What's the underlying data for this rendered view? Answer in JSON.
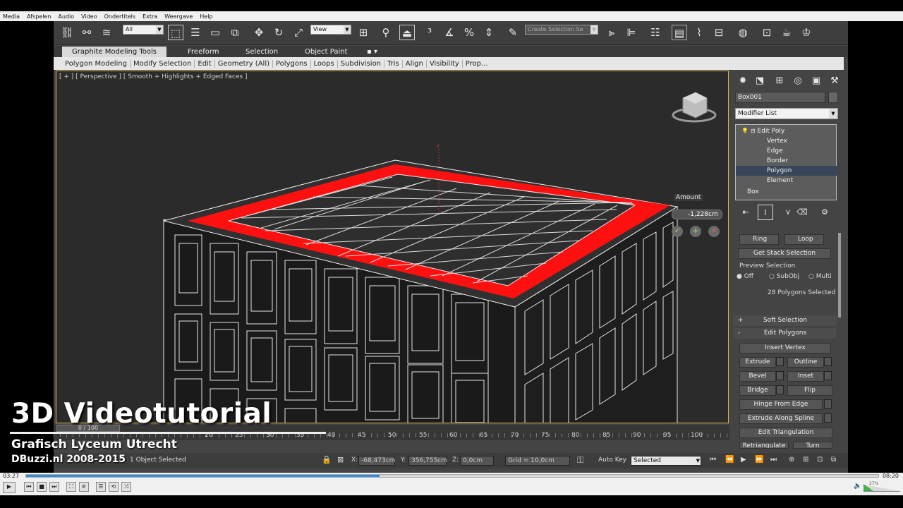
{
  "vlc": {
    "menu": [
      "Media",
      "Afspelen",
      "Audio",
      "Video",
      "Ondertitels",
      "Extra",
      "Weergave",
      "Help"
    ],
    "time_elapsed": "03:27",
    "time_total": "08:20",
    "progress": 0.415,
    "volume_label": "27%"
  },
  "toolbar": {
    "selection_filter": "All",
    "ref_coord": "View",
    "named_selection": "Create Selection Se"
  },
  "ribbon": {
    "tabs": [
      "Graphite Modeling Tools",
      "Freeform",
      "Selection",
      "Object Paint"
    ],
    "panels": [
      "Polygon Modeling",
      "Modify Selection",
      "Edit",
      "Geometry (All)",
      "Polygons",
      "Loops",
      "Subdivision",
      "Tris",
      "Align",
      "Visibility",
      "Prop..."
    ]
  },
  "viewport": {
    "label": "[ + ] [ Perspective ] [ Smooth + Highlights + Edged Faces ]",
    "caddy_title": "Amount",
    "caddy_value": "-1,228cm",
    "axis_z": "z"
  },
  "command_panel": {
    "object_name": "Box001",
    "modifier_list": "Modifier List",
    "stack": {
      "edit_poly": "Edit Poly",
      "vertex": "Vertex",
      "edge": "Edge",
      "border": "Border",
      "polygon": "Polygon",
      "element": "Element",
      "box": "Box"
    },
    "ring": "Ring",
    "loop": "Loop",
    "get_stack_selection": "Get Stack Selection",
    "preview_selection": "Preview Selection",
    "preview_off": "Off",
    "preview_subobj": "SubObj",
    "preview_multi": "Multi",
    "selected_info": "28 Polygons Selected",
    "soft_selection": "Soft Selection",
    "soft_sign": "+",
    "edit_polygons": "Edit Polygons",
    "edit_sign": "-",
    "insert_vertex": "Insert Vertex",
    "extrude": "Extrude",
    "outline": "Outline",
    "bevel": "Bevel",
    "inset": "Inset",
    "bridge": "Bridge",
    "flip": "Flip",
    "hinge_from_edge": "Hinge From Edge",
    "extrude_along_spline": "Extrude Along Spline",
    "edit_triangulation": "Edit Triangulation",
    "retriangulate": "Retriangulate",
    "turn": "Turn"
  },
  "timeline": {
    "slider": "0 / 100",
    "ticks": [
      "20",
      "25",
      "30",
      "35",
      "40",
      "45",
      "50",
      "55",
      "60",
      "65",
      "70",
      "75",
      "80",
      "85",
      "90",
      "95",
      "100"
    ]
  },
  "status": {
    "selection": "1 Object Selected",
    "x_label": "X:",
    "x": "-68,473cm",
    "y_label": "Y:",
    "y": "356,755cm",
    "z_label": "Z:",
    "z": "0,0cm",
    "grid": "Grid = 10,0cm",
    "auto_key": "Auto Key",
    "key_mode": "Selected"
  },
  "overlay": {
    "title": "3D Videotutorial",
    "school": "Grafisch Lyceum Utrecht",
    "credit": "DBuzzi.nl 2008-2015"
  },
  "colors": {
    "selection_red": "#ff1010",
    "viewport_bg": "#2b2b2b",
    "active_border": "#d8b54a"
  }
}
